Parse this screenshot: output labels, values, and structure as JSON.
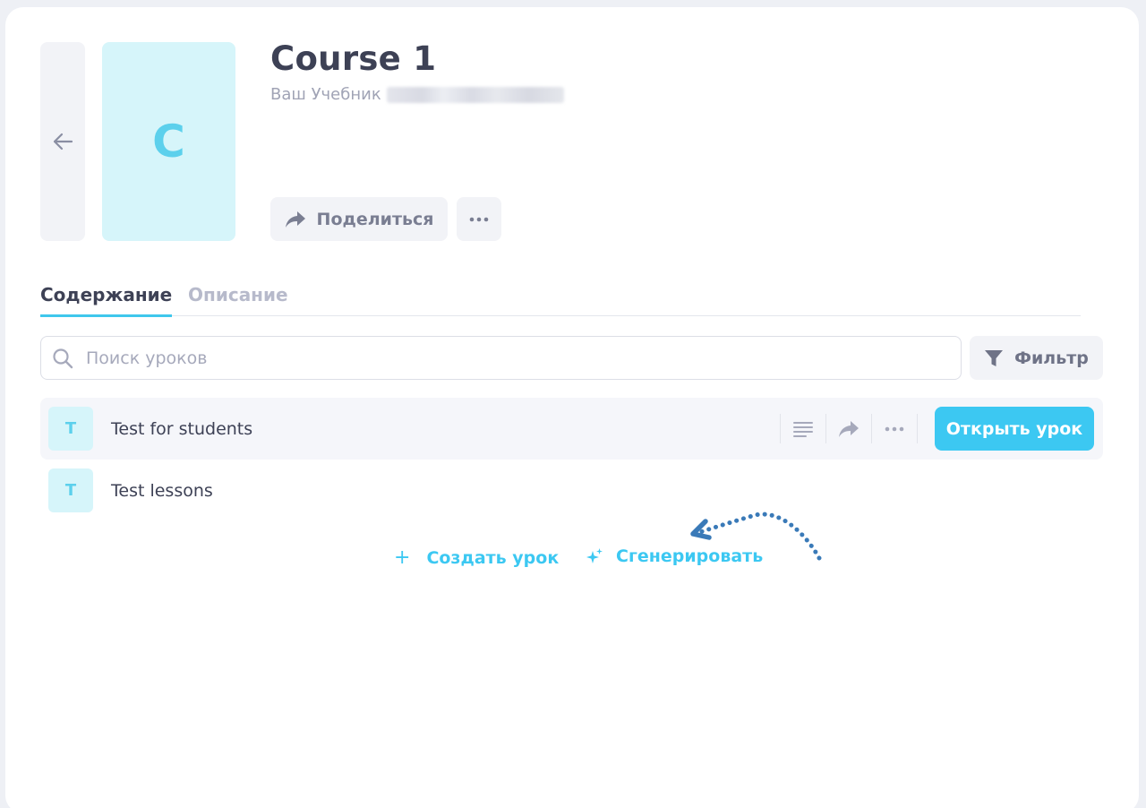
{
  "course": {
    "title": "Course 1",
    "cover_letter": "C",
    "subtitle": "Ваш Учебник"
  },
  "actions": {
    "share_label": "Поделиться",
    "more_icon": "ellipsis-icon",
    "back_icon": "arrow-left-icon"
  },
  "tabs": [
    {
      "label": "Содержание",
      "active": true
    },
    {
      "label": "Описание",
      "active": false
    }
  ],
  "search": {
    "placeholder": "Поиск уроков",
    "icon": "search-icon"
  },
  "filter": {
    "label": "Фильтр",
    "icon": "funnel-icon"
  },
  "lessons": [
    {
      "badge": "T",
      "title": "Test for students",
      "open_label": "Открыть урок",
      "highlighted": true
    },
    {
      "badge": "T",
      "title": "Test lessons",
      "highlighted": false
    }
  ],
  "bottom_actions": {
    "create_label": "Создать урок",
    "generate_label": "Сгенерировать"
  },
  "colors": {
    "accent": "#3cc8f2",
    "cover_bg": "#d6f5fa",
    "text_primary": "#3d4155",
    "text_muted": "#a0a3b5",
    "hint_arrow": "#3a7ab8"
  }
}
